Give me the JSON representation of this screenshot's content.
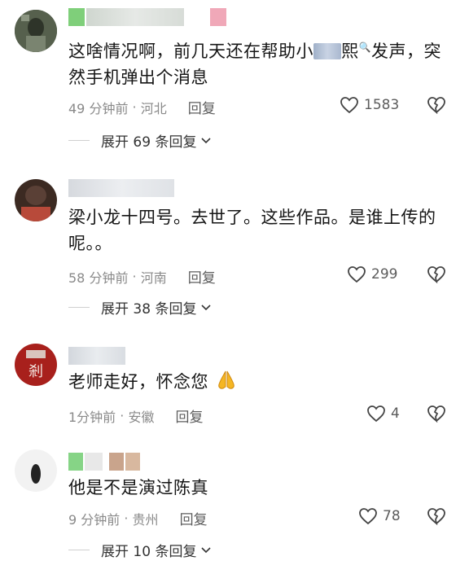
{
  "comments": [
    {
      "text_before": "这啥情况啊，前几天还在帮助小",
      "text_mid": "熙",
      "text_after": "发声，突然手机弹出个消息",
      "time": "49 分钟前",
      "location": "河北",
      "reply_label": "回复",
      "likes": "1583",
      "expand_label": "展开 69 条回复"
    },
    {
      "text": "梁小龙十四号。去世了。这些作品。是谁上传的呢。。",
      "time": "58 分钟前",
      "location": "河南",
      "reply_label": "回复",
      "likes": "299",
      "expand_label": "展开 38 条回复"
    },
    {
      "text": "老师走好，怀念您",
      "time": "1分钟前",
      "location": "安徽",
      "reply_label": "回复",
      "likes": "4"
    },
    {
      "text": "他是不是演过陈真",
      "time": "9 分钟前",
      "location": "贵州",
      "reply_label": "回复",
      "likes": "78",
      "expand_label": "展开 10 条回复"
    }
  ],
  "icons": {
    "heart": "heart-icon",
    "dislike": "broken-heart-icon",
    "chevron": "chevron-down-icon",
    "search": "search-icon",
    "pray": "praying-hands-emoji"
  },
  "colors": {
    "text": "#161616",
    "meta": "#8a8a8a",
    "action": "#5c5c5c"
  }
}
